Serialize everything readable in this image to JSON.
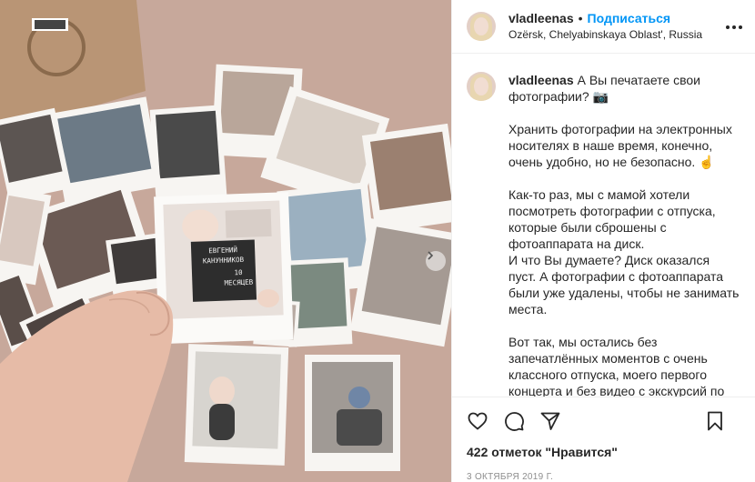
{
  "header": {
    "username": "vladleenas",
    "separator": "•",
    "follow_label": "Подписаться",
    "location": "Ozërsk, Chelyabinskaya Oblast', Russia"
  },
  "caption": {
    "username": "vladleenas",
    "first": "А Вы печатаете свои фотографии? 📷",
    "paragraphs": [
      "Хранить фотографии на электронных носителях в наше время, конечно, очень удобно, но не безопасно. ☝",
      "Как-то раз, мы с мамой хотели посмотреть фотографии с отпуска, которые были сброшены с фотоаппарата на диск.\nИ что Вы думаете? Диск оказался пуст. А фотографии с фотоаппарата были уже удалены, чтобы не занимать места.",
      "Вот так, мы остались без запечатлённых моментов с очень классного отпуска, моего первого концерта и без видео с экскурсий по"
    ]
  },
  "photo": {
    "card_text_line1": "ЕВГЕНИЙ",
    "card_text_line2": "КАНУННИКОВ",
    "card_text_line3": "10",
    "card_text_line4": "МЕСЯЦЕВ"
  },
  "footer": {
    "likes": "422 отметок \"Нравится\"",
    "date": "3 ОКТЯБРЯ 2019 Г."
  },
  "colors": {
    "accent": "#0095f6",
    "text": "#262626",
    "muted": "#8e8e8e",
    "border": "#efefef"
  }
}
